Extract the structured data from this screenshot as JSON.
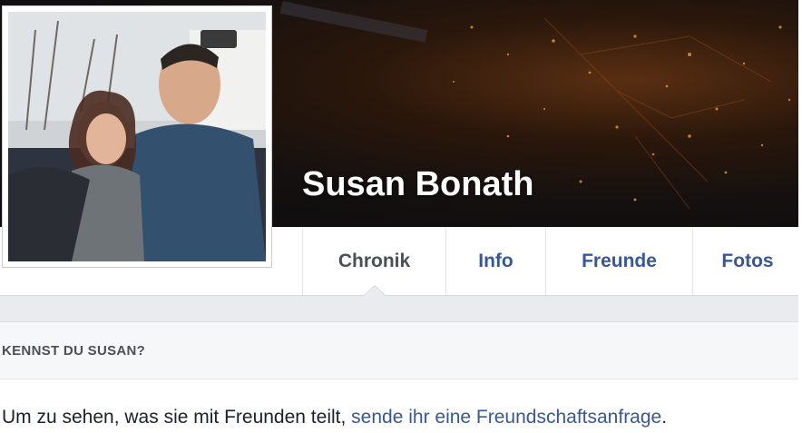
{
  "profile": {
    "name": "Susan Bonath",
    "photo_alt": "Profilbild"
  },
  "tabs": [
    {
      "label": "Chronik",
      "active": true
    },
    {
      "label": "Info",
      "active": false
    },
    {
      "label": "Freunde",
      "active": false
    },
    {
      "label": "Fotos",
      "active": false
    }
  ],
  "card": {
    "heading": "KENNST DU SUSAN?",
    "text_before": "Um zu sehen, was sie mit Freunden teilt, ",
    "link_text": "sende ihr eine Freundschaftsanfrage",
    "text_after": "."
  },
  "colors": {
    "link": "#365899",
    "tab_active": "#4b4f56",
    "page_bg": "#e9ebee"
  }
}
